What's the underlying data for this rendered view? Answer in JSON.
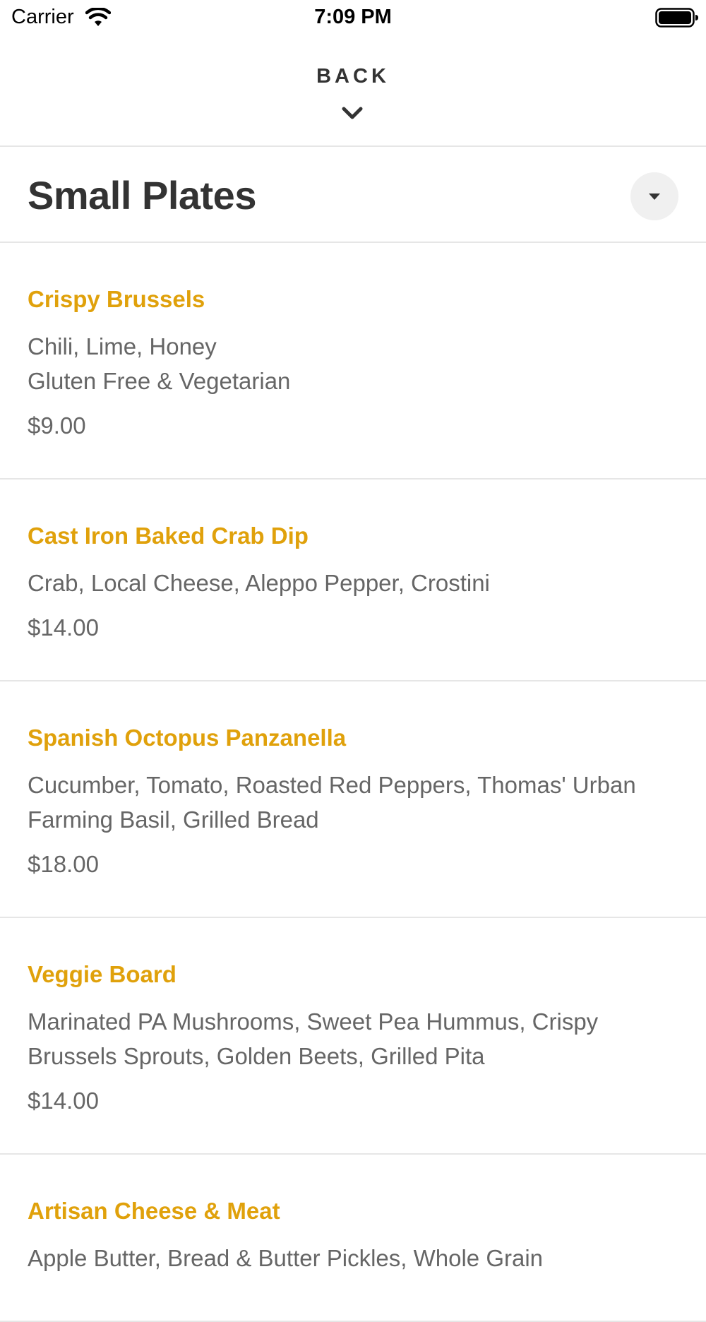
{
  "status_bar": {
    "carrier": "Carrier",
    "time": "7:09 PM",
    "wifi_icon": "wifi-icon",
    "battery_icon": "battery-full-icon"
  },
  "header": {
    "back_label": "BACK",
    "chevron_icon": "chevron-down-icon"
  },
  "section": {
    "title": "Small Plates",
    "toggle_icon": "caret-down-icon"
  },
  "colors": {
    "item_name": "#e0a10b",
    "text_secondary": "#666666",
    "title_text": "#333333",
    "divider": "#e6e6e6"
  },
  "menu_items": [
    {
      "name": "Crispy Brussels",
      "description_lines": [
        "Chili, Lime, Honey",
        "Gluten Free & Vegetarian"
      ],
      "price": "$9.00"
    },
    {
      "name": "Cast Iron Baked Crab Dip",
      "description_lines": [
        "Crab, Local Cheese, Aleppo Pepper, Crostini"
      ],
      "price": "$14.00"
    },
    {
      "name": "Spanish Octopus Panzanella",
      "description_lines": [
        "Cucumber, Tomato, Roasted Red Peppers, Thomas' Urban",
        "Farming Basil, Grilled Bread"
      ],
      "price": "$18.00"
    },
    {
      "name": "Veggie Board",
      "description_lines": [
        "Marinated PA Mushrooms, Sweet Pea Hummus, Crispy",
        "Brussels Sprouts, Golden Beets, Grilled Pita"
      ],
      "price": "$14.00"
    },
    {
      "name": "Artisan Cheese & Meat",
      "description_lines": [
        "Apple Butter, Bread & Butter Pickles, Whole Grain"
      ],
      "price": ""
    }
  ]
}
